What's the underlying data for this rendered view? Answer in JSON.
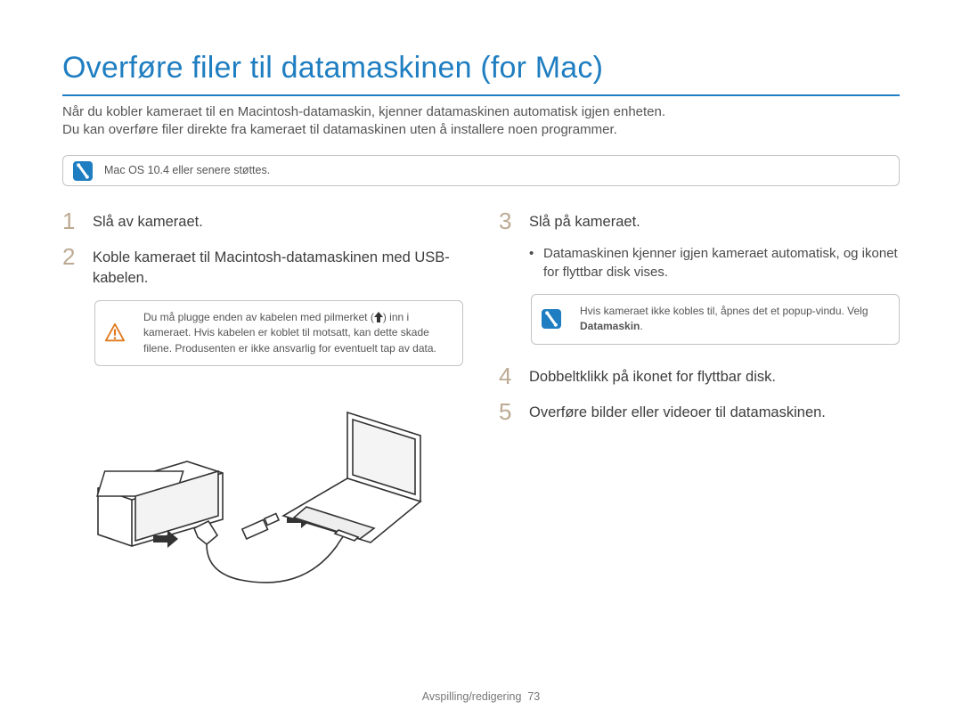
{
  "title": "Overføre filer til datamaskinen (for Mac)",
  "intro_line1": "Når du kobler kameraet til en Macintosh-datamaskin, kjenner datamaskinen automatisk igjen enheten.",
  "intro_line2": "Du kan overføre filer direkte fra kameraet til datamaskinen uten å installere noen programmer.",
  "mac_note": "Mac OS 10.4 eller senere støttes.",
  "left": {
    "step1_num": "1",
    "step1_text": "Slå av kameraet.",
    "step2_num": "2",
    "step2_text": "Koble kameraet til Macintosh-datamaskinen med USB-kabelen.",
    "warn_pre": "Du må plugge enden av kabelen med pilmerket (",
    "warn_post": ") inn i kameraet. Hvis kabelen er koblet til motsatt, kan dette skade filene. Produsenten er ikke ansvarlig for eventuelt tap av data."
  },
  "right": {
    "step3_num": "3",
    "step3_text": "Slå på kameraet.",
    "bullet": "Datamaskinen kjenner igjen kameraet automatisk, og ikonet for flyttbar disk vises.",
    "info_line1": "Hvis kameraet ikke kobles til, åpnes det et popup-vindu. Velg ",
    "info_bold": "Datamaskin",
    "info_after": ".",
    "step4_num": "4",
    "step4_text": "Dobbeltklikk på ikonet for flyttbar disk.",
    "step5_num": "5",
    "step5_text": "Overføre bilder eller videoer til datamaskinen."
  },
  "footer_section": "Avspilling/redigering",
  "footer_page": "73"
}
